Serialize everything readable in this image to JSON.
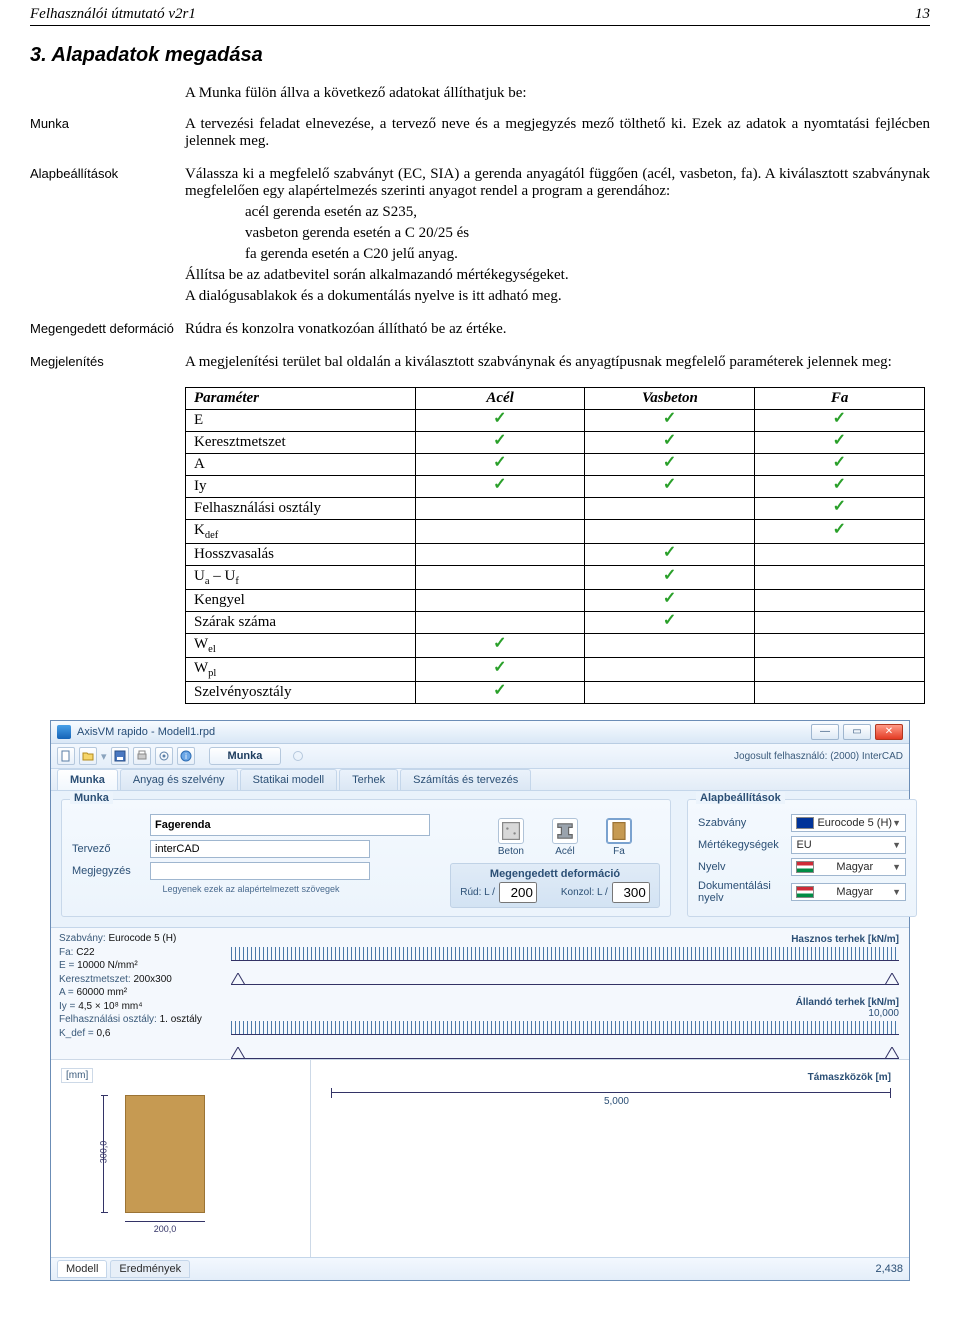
{
  "header": {
    "title": "Felhasználói útmutató v2r1",
    "page": "13"
  },
  "section": {
    "number": "3.",
    "title": "Alapadatok megadása"
  },
  "intro": "A Munka fülön állva a következő adatokat állíthatjuk be:",
  "munka": {
    "label": "Munka",
    "p1": "A tervezési feladat elnevezése, a tervező neve és a megjegyzés mező tölthető ki. Ezek az adatok a nyomtatási fejlécben jelennek meg."
  },
  "alap": {
    "label": "Alapbeállítások",
    "p1": "Válassza ki a megfelelő szabványt (EC, SIA) a gerenda anyagától függően (acél, vasbeton, fa). A kiválasztott szabványnak megfelelően egy alapértelmezés szerinti anyagot rendel a program a gerendához:",
    "li1": "acél gerenda esetén az S235,",
    "li2": "vasbeton gerenda esetén a C 20/25 és",
    "li3": "fa gerenda esetén a C20 jelű anyag.",
    "p2": "Állítsa be az adatbevitel során alkalmazandó mértékegységeket.",
    "p3": "A dialógusablakok és a dokumentálás nyelve is itt adható meg."
  },
  "deform": {
    "label": "Megengedett deformáció",
    "p1": "Rúdra és konzolra vonatkozóan állítható be az értéke."
  },
  "megjel": {
    "label": "Megjelenítés",
    "p1": "A megjelenítési terület bal oldalán a kiválasztott szabványnak és anyagtípusnak megfelelő paraméterek jelennek meg:"
  },
  "table": {
    "h_param": "Paraméter",
    "h_acel": "Acél",
    "h_vas": "Vasbeton",
    "h_fa": "Fa",
    "rows": {
      "e": "E",
      "kereszt": "Keresztmetszet",
      "a": "A",
      "iy": "Iy",
      "felh": "Felhasználási osztály",
      "kdef_pre": "K",
      "kdef_sub": "def",
      "hossz": "Hosszvasalás",
      "uauf": "U",
      "ua_sub": "a",
      "uf_sep": " – U",
      "uf_sub": "f",
      "kengyel": "Kengyel",
      "szarak": "Szárak száma",
      "wel_pre": "W",
      "wel_sub": "el",
      "wpl_pre": "W",
      "wpl_sub": "pl",
      "szelv": "Szelvényosztály"
    }
  },
  "app": {
    "title": "AxisVM rapido - Modell1.rpd",
    "license": "Jogosult felhasználó: (2000) InterCAD",
    "activeTab": "Munka",
    "tabs": {
      "t1": "Munka",
      "t2": "Anyag és szelvény",
      "t3": "Statikai modell",
      "t4": "Terhek",
      "t5": "Számítás és tervezés"
    },
    "grp_munka": "Munka",
    "nameVal": "Fagerenda",
    "designerLbl": "Tervező",
    "designerVal": "interCAD",
    "noteLbl": "Megjegyzés",
    "noteVal": "",
    "defaultsNote": "Legyenek ezek az alapértelmezett szövegek",
    "mat_beton": "Beton",
    "mat_acel": "Acél",
    "mat_fa": "Fa",
    "def_title": "Megengedett deformáció",
    "def_rud": "Rúd: L /",
    "def_rud_v": "200",
    "def_kon": "Konzol: L /",
    "def_kon_v": "300",
    "grp_set": "Alapbeállítások",
    "set_szabv": "Szabvány",
    "set_szabv_v": "Eurocode 5 (H)",
    "set_mert": "Mértékegységek",
    "set_mert_v": "EU",
    "set_nyelv": "Nyelv",
    "set_nyelv_v": "Magyar",
    "set_dok": "Dokumentálási nyelv",
    "set_dok_v": "Magyar",
    "params": {
      "szabv_k": "Szabvány:",
      "szabv_v": "Eurocode 5 (H)",
      "fa_k": "Fa:",
      "fa_v": "C22",
      "e_k": "E =",
      "e_v": "10000 N/mm²",
      "ker_k": "Keresztmetszet:",
      "ker_v": "200x300",
      "a_k": "A =",
      "a_v": "60000 mm²",
      "iy_k": "Iy =",
      "iy_v": "4,5 × 10⁸ mm⁴",
      "fo_k": "Felhasználási osztály:",
      "fo_v": "1. osztály",
      "kdef_k": "K_def =",
      "kdef_v": "0,6"
    },
    "hasznos": "Hasznos terhek [kN/m]",
    "allando": "Állandó terhek [kN/m]",
    "allando_v": "10,000",
    "sect_unit": "[mm]",
    "sect_h": "300,0",
    "sect_w": "200,0",
    "span_lbl": "Támaszközök [m]",
    "span_v": "5,000",
    "status": {
      "modell": "Modell",
      "ered": "Eredmények",
      "val": "2,438"
    }
  }
}
